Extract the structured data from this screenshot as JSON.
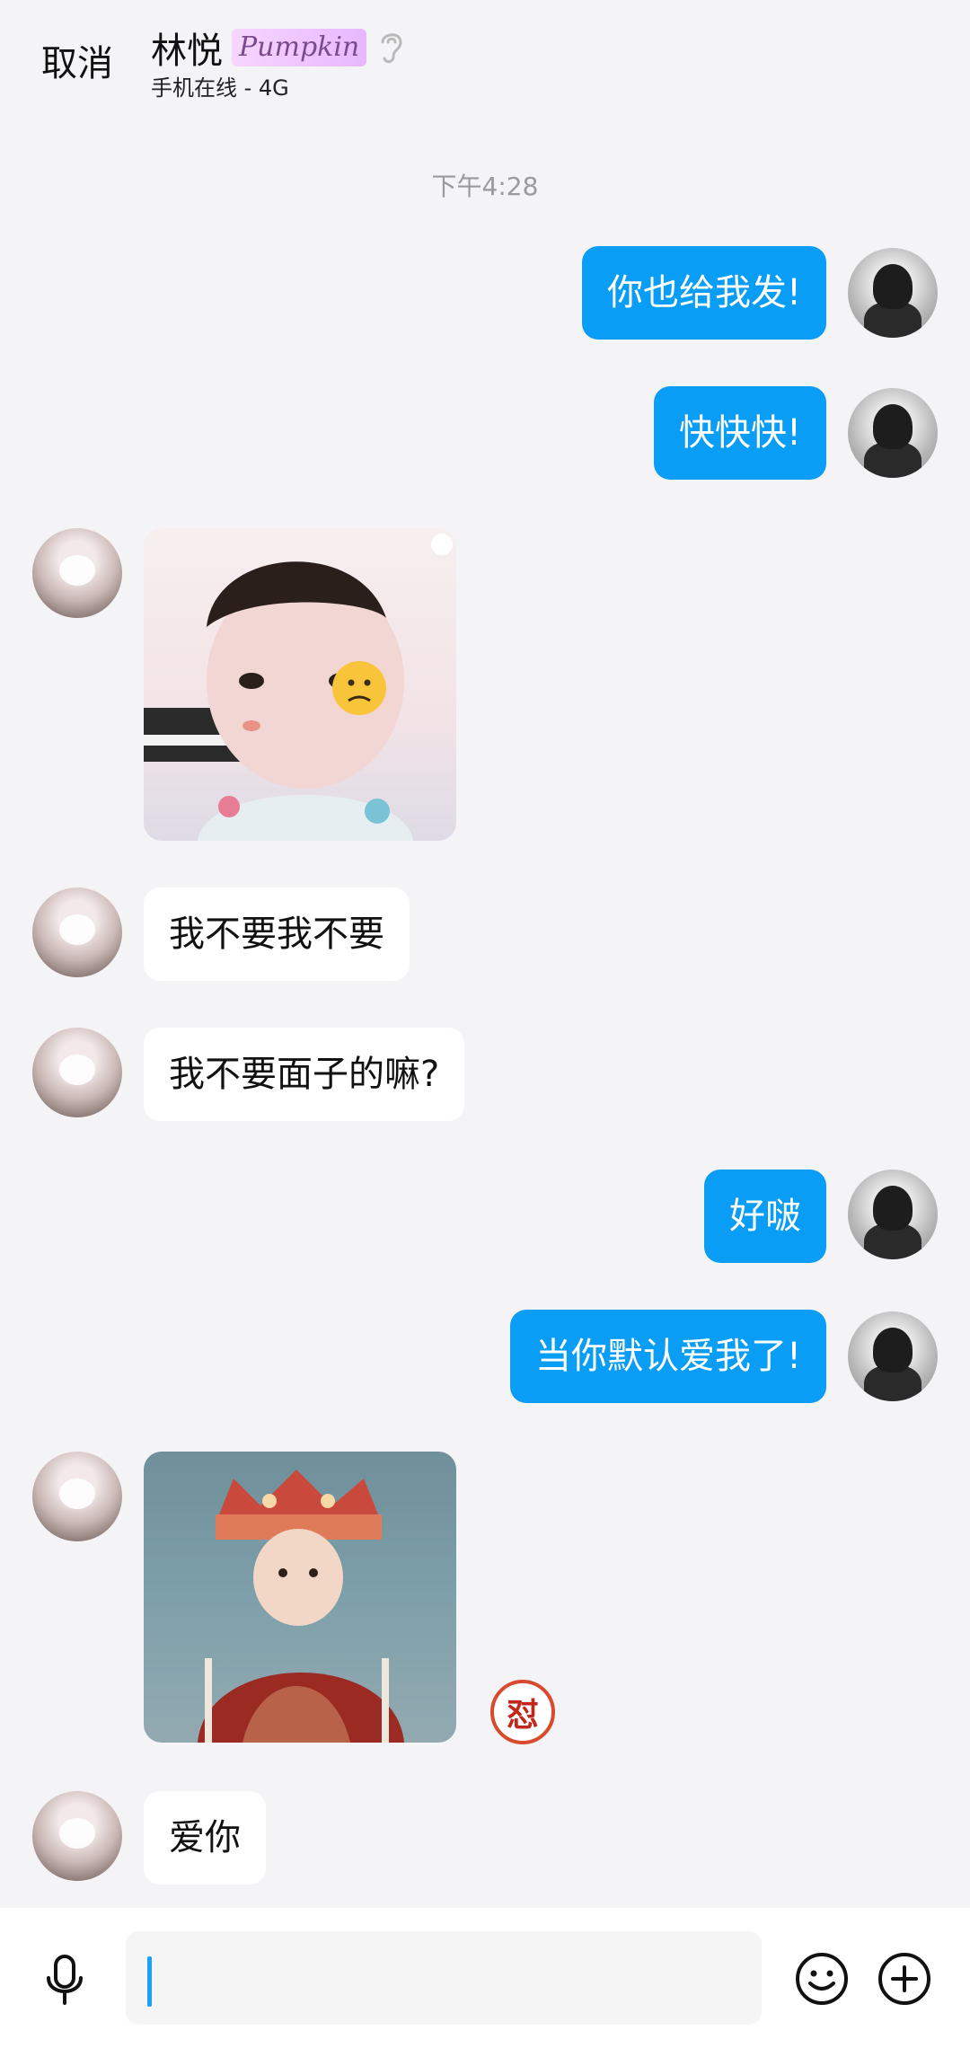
{
  "header": {
    "cancel_label": "取消",
    "contact_name": "林悦",
    "badge_text": "Pumpkin",
    "status": "手机在线 - 4G"
  },
  "chat": {
    "timestamp": "下午4:28",
    "messages": [
      {
        "from": "me",
        "text": "你也给我发!"
      },
      {
        "from": "me",
        "text": "快快快!"
      },
      {
        "from": "her",
        "type": "sticker"
      },
      {
        "from": "her",
        "text": "我不要我不要"
      },
      {
        "from": "her",
        "text": "我不要面子的嘛?"
      },
      {
        "from": "me",
        "text": "好啵"
      },
      {
        "from": "me",
        "text": "当你默认爱我了!"
      },
      {
        "from": "her",
        "type": "sticker"
      },
      {
        "from": "her",
        "text": "爱你"
      }
    ],
    "reaction_glyph": "怼"
  },
  "colors": {
    "outgoing_bubble": "#0a9df5",
    "incoming_bubble": "#ffffff",
    "background": "#f4f3f6"
  },
  "icons": {
    "mic": "mic-icon",
    "emoji": "emoji-icon",
    "plus": "plus-icon",
    "ear": "ear-icon"
  }
}
